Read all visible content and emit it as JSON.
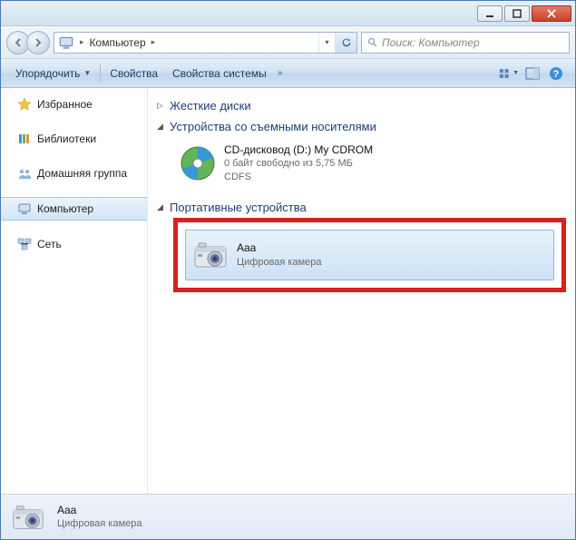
{
  "titlebar": {
    "minimize_glyph": "━",
    "maximize_glyph": "▢",
    "close_glyph": "✕"
  },
  "address": {
    "segment": "Компьютер",
    "chevron": "▸",
    "refresh_tooltip": "Обновить"
  },
  "search": {
    "placeholder": "Поиск: Компьютер"
  },
  "toolbar": {
    "organize": "Упорядочить",
    "properties": "Свойства",
    "system_properties": "Свойства системы",
    "more": "»"
  },
  "sidebar": {
    "items": [
      {
        "label": "Избранное",
        "icon": "star"
      },
      {
        "label": "Библиотеки",
        "icon": "library"
      },
      {
        "label": "Домашняя группа",
        "icon": "homegroup"
      },
      {
        "label": "Компьютер",
        "icon": "computer",
        "selected": true
      },
      {
        "label": "Сеть",
        "icon": "network"
      }
    ]
  },
  "content": {
    "groups": [
      {
        "title": "Жесткие диски",
        "expanded": false,
        "items": []
      },
      {
        "title": "Устройства со съемными носителями",
        "expanded": true,
        "items": [
          {
            "title": "CD-дисковод (D:) My CDROM",
            "sub1": "0 байт свободно из 5,75 МБ",
            "sub2": "CDFS",
            "icon": "cd"
          }
        ]
      },
      {
        "title": "Портативные устройства",
        "expanded": true,
        "items": [
          {
            "title": "Aaa",
            "sub1": "Цифровая камера",
            "icon": "camera",
            "selected": true,
            "highlighted": true
          }
        ]
      }
    ]
  },
  "statusbar": {
    "title": "Aaa",
    "subtitle": "Цифровая камера",
    "icon": "camera"
  }
}
